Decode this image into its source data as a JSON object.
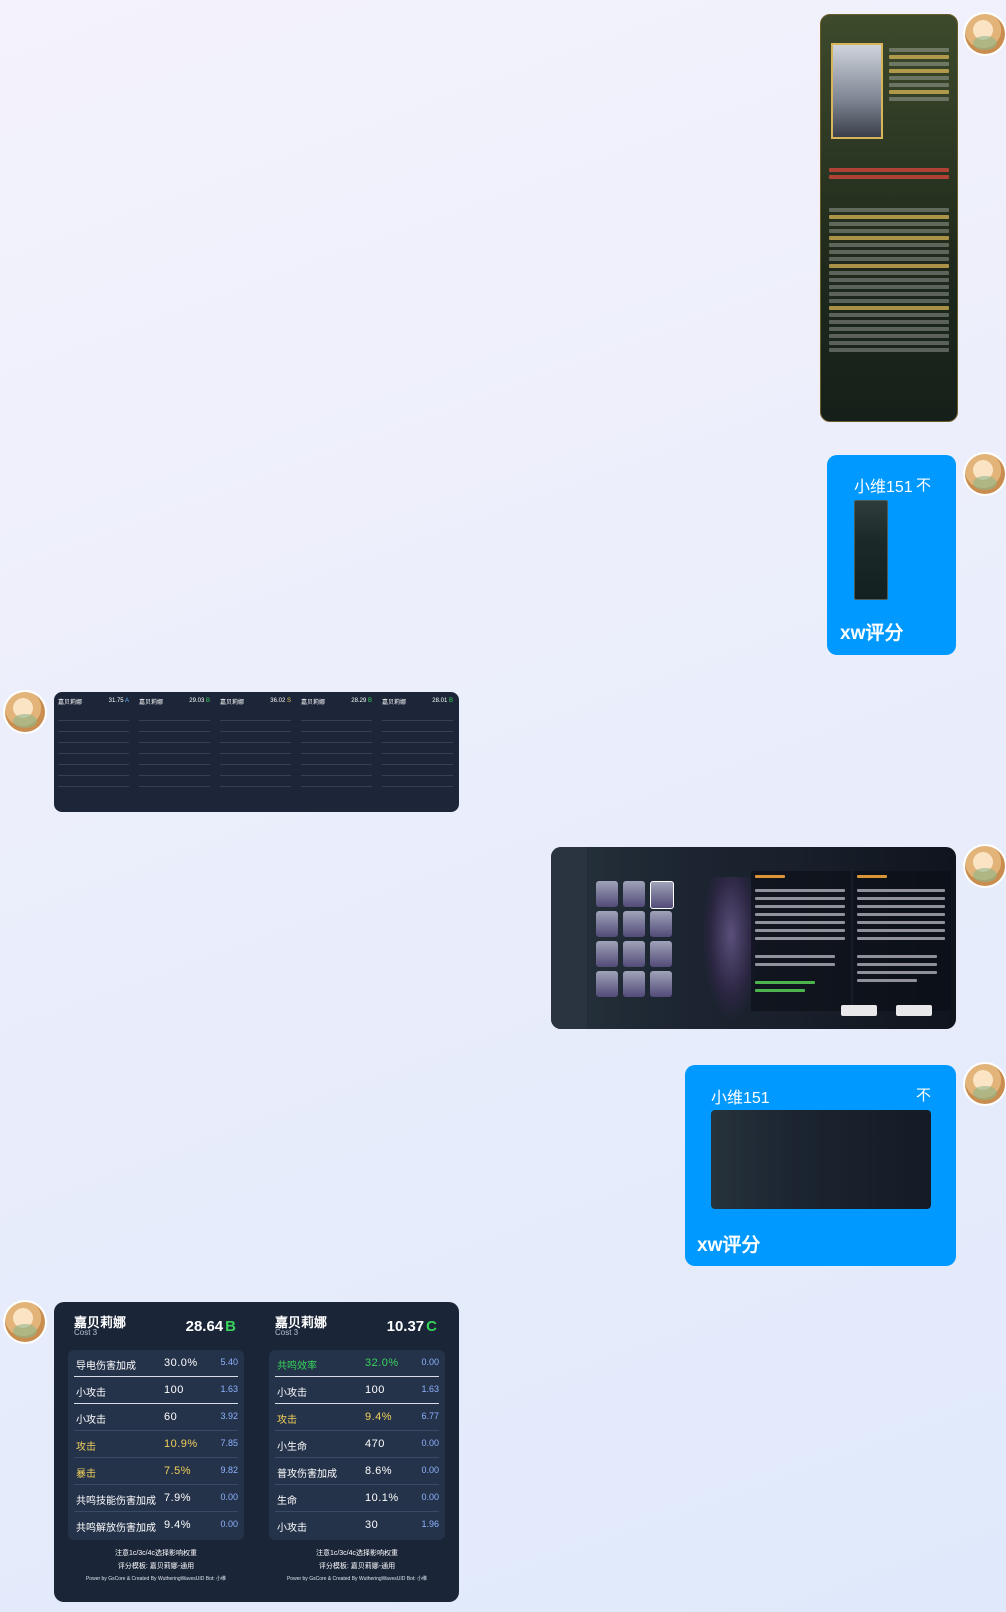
{
  "messages": {
    "fwd1": {
      "title": "小维151",
      "close": "不",
      "caption": "xw评分"
    },
    "fwd2": {
      "title": "小维151",
      "close": "不",
      "caption": "xw评分"
    }
  },
  "strip_cards": [
    {
      "name": "嘉贝莉娜",
      "score": "31.75",
      "grade": "A"
    },
    {
      "name": "嘉贝莉娜",
      "score": "29.03",
      "grade": "B"
    },
    {
      "name": "嘉贝莉娜",
      "score": "36.02",
      "grade": "S"
    },
    {
      "name": "嘉贝莉娜",
      "score": "28.29",
      "grade": "B"
    },
    {
      "name": "嘉贝莉娜",
      "score": "28.01",
      "grade": "B"
    }
  ],
  "score_cards": [
    {
      "name": "嘉贝莉娜",
      "cost": "Cost 3",
      "score": "28.64",
      "grade": "B",
      "grade_color": "#37d45a",
      "rows": [
        {
          "label": "导电伤害加成",
          "value": "30.0%",
          "points": "5.40",
          "style": ""
        },
        {
          "label": "小攻击",
          "value": "100",
          "points": "1.63",
          "style": ""
        },
        {
          "label": "小攻击",
          "value": "60",
          "points": "3.92",
          "style": ""
        },
        {
          "label": "攻击",
          "value": "10.9%",
          "points": "7.85",
          "style": "hl"
        },
        {
          "label": "暴击",
          "value": "7.5%",
          "points": "9.82",
          "style": "hl"
        },
        {
          "label": "共鸣技能伤害加成",
          "value": "7.9%",
          "points": "0.00",
          "style": ""
        },
        {
          "label": "共鸣解放伤害加成",
          "value": "9.4%",
          "points": "0.00",
          "style": ""
        }
      ],
      "foot1": "注意1c/3c/4c选择影响权重",
      "foot2": "评分模板: 嘉贝莉娜-通用",
      "foot3": "Power by GsCore & Created By WutheringWavesUID  Bot: 小维"
    },
    {
      "name": "嘉贝莉娜",
      "cost": "Cost 3",
      "score": "10.37",
      "grade": "C",
      "grade_color": "#37d45a",
      "rows": [
        {
          "label": "共鸣效率",
          "value": "32.0%",
          "points": "0.00",
          "style": "hg"
        },
        {
          "label": "小攻击",
          "value": "100",
          "points": "1.63",
          "style": ""
        },
        {
          "label": "攻击",
          "value": "9.4%",
          "points": "6.77",
          "style": "hl"
        },
        {
          "label": "小生命",
          "value": "470",
          "points": "0.00",
          "style": ""
        },
        {
          "label": "普攻伤害加成",
          "value": "8.6%",
          "points": "0.00",
          "style": ""
        },
        {
          "label": "生命",
          "value": "10.1%",
          "points": "0.00",
          "style": ""
        },
        {
          "label": "小攻击",
          "value": "30",
          "points": "1.96",
          "style": ""
        }
      ],
      "foot1": "注意1c/3c/4c选择影响权重",
      "foot2": "评分模板: 嘉贝莉娜-通用",
      "foot3": "Power by GsCore & Created By WutheringWavesUID  Bot: 小维"
    }
  ]
}
